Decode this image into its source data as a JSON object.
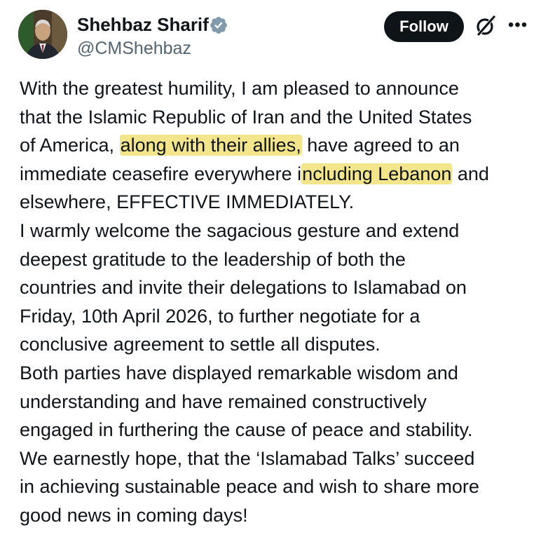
{
  "header": {
    "display_name": "Shehbaz Sharif",
    "handle": "@CMShehbaz",
    "follow_label": "Follow",
    "more_label": "•••",
    "verified_icon": "verified-badge-icon",
    "grok_icon": "grok-icon"
  },
  "colors": {
    "highlight": "#f3e58b",
    "verified": "#829aab",
    "button_bg": "#0f1419"
  },
  "tweet": {
    "l1": "With the greatest humility, I am pleased to announce",
    "l2": "that the Islamic Republic of Iran and the United States",
    "l3a": "of America, ",
    "l3b": "along with their allies,",
    "l3c": " have agreed to an",
    "l4a": "immediate ceasefire everywhere i",
    "l4b": "ncluding Lebanon",
    "l4c": " and",
    "l5": "elsewhere, EFFECTIVE IMMEDIATELY.",
    "l6": "I warmly welcome the sagacious gesture and extend",
    "l7": "deepest gratitude to the leadership of both the",
    "l8": "countries and invite their delegations to Islamabad on",
    "l9": "Friday, 10th April 2026, to further negotiate for a",
    "l10": "conclusive agreement to settle all disputes.",
    "l11": "Both parties have displayed remarkable wisdom and",
    "l12": "understanding and have remained constructively",
    "l13": "engaged in furthering the cause of peace and stability.",
    "l14": "We earnestly hope, that the ‘Islamabad Talks’ succeed",
    "l15": "in achieving sustainable peace and wish to share more",
    "l16": "good news in coming days!"
  }
}
